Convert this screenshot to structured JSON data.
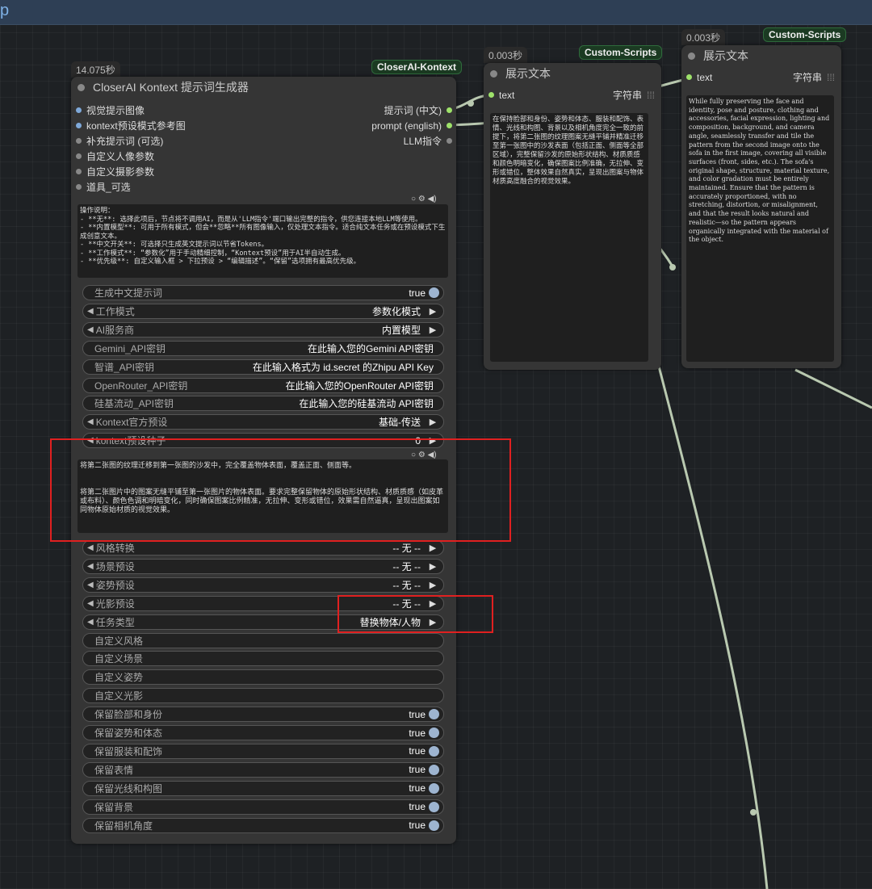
{
  "topbar": {
    "fragment": "p"
  },
  "node_main": {
    "time": "14.075秒",
    "badge": "CloserAI-Kontext",
    "title": "CloserAI Kontext 提示词生成器",
    "inputs": [
      {
        "label": "视觉提示图像",
        "color": "#7fa9d9"
      },
      {
        "label": "kontext预设模式参考图",
        "color": "#7fa9d9"
      },
      {
        "label": "补充提示词 (可选)",
        "color": "#888888"
      },
      {
        "label": "自定义人像参数",
        "color": "#888888"
      },
      {
        "label": "自定义摄影参数",
        "color": "#888888"
      },
      {
        "label": "道具_可选",
        "color": "#888888"
      }
    ],
    "outputs": [
      {
        "label": "提示词 (中文)",
        "color": "#9ee26a"
      },
      {
        "label": "prompt (english)",
        "color": "#9ee26a"
      },
      {
        "label": "LLM指令",
        "color": "#888888"
      }
    ],
    "instructions": "操作说明：\n- **无**: 选择此项后，节点将不调用AI，而是从'LLM指令'端口输出完整的指令，供您连接本地LLM等使用。\n- **内置模型**: 可用于所有模式，但会**忽略**所有图像输入，仅处理文本指令。适合纯文本任务或在预设模式下生成创意文本。\n- **中文开关**: 可选择只生成英文提示词以节省Tokens。\n- **工作模式**: “参数化”用于手动精细控制，“Kontext预设”用于AI半自动生成。\n- **优先级**: 自定义输入框 > 下拉预设 > “编辑描述”。“保留”选项拥有最高优先级。",
    "widgets_a": [
      {
        "type": "toggle",
        "label": "生成中文提示词",
        "value": "true"
      },
      {
        "type": "combo",
        "label": "工作模式",
        "value": "参数化模式"
      },
      {
        "type": "combo",
        "label": "AI服务商",
        "value": "内置模型"
      },
      {
        "type": "text",
        "label": "Gemini_API密钥",
        "value": "在此输入您的Gemini API密钥"
      },
      {
        "type": "text",
        "label": "智谱_API密钥",
        "value": "在此输入格式为 id.secret 的Zhipu API Key"
      },
      {
        "type": "text",
        "label": "OpenRouter_API密钥",
        "value": "在此输入您的OpenRouter API密钥"
      },
      {
        "type": "text",
        "label": "硅基流动_API密钥",
        "value": "在此输入您的硅基流动 API密钥"
      },
      {
        "type": "combo",
        "label": "Kontext官方预设",
        "value": "基础-传送"
      },
      {
        "type": "combo",
        "label": "kontext预设种子",
        "value": "0"
      }
    ],
    "edit_text": "将第二张图的纹理迁移到第一张图的沙发中，完全覆盖物体表面，覆盖正面、侧面等。\n\n\n将第二张图片中的图案无缝平铺至第一张图片的物体表面。要求完整保留物体的原始形状结构、材质质感（如皮革或布料）、颜色色调和明暗变化，同时确保图案比例精准，无拉伸、变形或错位，效果需自然逼真，呈现出图案如同物体原始材质的视觉效果。",
    "widgets_b": [
      {
        "type": "combo",
        "label": "风格转换",
        "value": "-- 无 --"
      },
      {
        "type": "combo",
        "label": "场景预设",
        "value": "-- 无 --"
      },
      {
        "type": "combo",
        "label": "姿势预设",
        "value": "-- 无 --"
      },
      {
        "type": "combo",
        "label": "光影预设",
        "value": "-- 无 --"
      },
      {
        "type": "combo",
        "label": "任务类型",
        "value": "替换物体/人物"
      },
      {
        "type": "text",
        "label": "自定义风格",
        "value": ""
      },
      {
        "type": "text",
        "label": "自定义场景",
        "value": ""
      },
      {
        "type": "text",
        "label": "自定义姿势",
        "value": ""
      },
      {
        "type": "text",
        "label": "自定义光影",
        "value": ""
      },
      {
        "type": "toggle",
        "label": "保留脸部和身份",
        "value": "true"
      },
      {
        "type": "toggle",
        "label": "保留姿势和体态",
        "value": "true"
      },
      {
        "type": "toggle",
        "label": "保留服装和配饰",
        "value": "true"
      },
      {
        "type": "toggle",
        "label": "保留表情",
        "value": "true"
      },
      {
        "type": "toggle",
        "label": "保留光线和构图",
        "value": "true"
      },
      {
        "type": "toggle",
        "label": "保留背景",
        "value": "true"
      },
      {
        "type": "toggle",
        "label": "保留相机角度",
        "value": "true"
      }
    ]
  },
  "node_show1": {
    "time": "0.003秒",
    "badge": "Custom-Scripts",
    "title": "展示文本",
    "input_label": "text",
    "type_label": "字符串",
    "text": "在保持脸部和身份、姿势和体态、服装和配饰、表情、光线和构图、背景以及相机角度完全一致的前提下，将第二张图的纹理图案无缝平铺并精准迁移至第一张图中的沙发表面（包括正面、侧面等全部区域），完整保留沙发的原始形状结构、材质质感和颜色明暗变化，确保图案比例准确，无拉伸、变形或错位，整体效果自然真实，呈现出图案与物体材质高度融合的视觉效果。"
  },
  "node_show2": {
    "time": "0.003秒",
    "badge": "Custom-Scripts",
    "title": "展示文本",
    "input_label": "text",
    "type_label": "字符串",
    "text": "While fully preserving the face and identity, pose and posture, clothing and accessories, facial expression, lighting and composition, background, and camera angle, seamlessly transfer and tile the pattern from the second image onto the sofa in the first image, covering all visible surfaces (front, sides, etc.). The sofa's original shape, structure, material texture, and color gradation must be entirely maintained. Ensure that the pattern is accurately proportioned, with no stretching, distortion, or misalignment, and that the result looks natural and realistic—so the pattern appears organically integrated with the material of the object."
  },
  "colors": {
    "node_bg": "#353535",
    "canvas": "#1e2124",
    "wire": "#b9c9b0",
    "accent_green": "#9ee26a",
    "highlight": "#e02020"
  }
}
